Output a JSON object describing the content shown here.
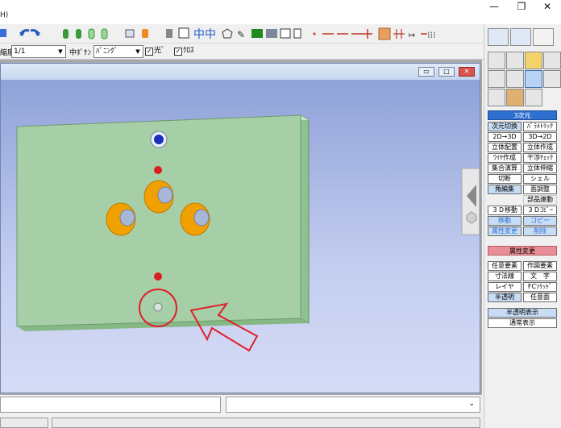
{
  "window": {
    "menu_fragment": "H)",
    "minimize": "—",
    "restore": "❐",
    "close": "✕"
  },
  "toolbar2": {
    "scale_label": "縮度",
    "scale_value": "1/1",
    "line_type_label": "中ﾎﾟｹﾝ",
    "line_type_value": "ﾊﾟﾆﾝｸﾞ",
    "check1_label": "光ﾞ",
    "check2_label": "ｸﾛｽ"
  },
  "child_window": {
    "min": "▭",
    "max": "□",
    "close": "✕"
  },
  "panel": {
    "mode_header": "3次元",
    "commands": [
      {
        "left": "次元切換",
        "right": "ﾊﾟﾗﾒﾄﾘｯｸ"
      },
      {
        "left": "2D→3D",
        "right": "3D→2D"
      },
      {
        "left": "立体配置",
        "right": "立体作成"
      },
      {
        "left": "ﾜｲﾔ作成",
        "right": "干渉ﾁｪｯｸ"
      },
      {
        "left": "集合演算",
        "right": "立体伸縮"
      },
      {
        "left": "切断",
        "right": "シェル"
      },
      {
        "left": "角編集",
        "right": "面調整"
      },
      {
        "left": "",
        "right": "部品連動"
      },
      {
        "left": "３Ｄ移動",
        "right": "３Ｄｺﾋﾟｰ"
      },
      {
        "left": "移動",
        "right": "コピー"
      },
      {
        "left": "属性変更",
        "right": "削除"
      }
    ],
    "attr_header": "属性変更",
    "attr_commands": [
      {
        "left": "任意要素",
        "right": "作図要素"
      },
      {
        "left": "寸法線",
        "right": "文　字"
      },
      {
        "left": "レイヤ",
        "right": "FCｿﾘｯﾄﾞ"
      },
      {
        "left": "半透明",
        "right": "任意面"
      }
    ],
    "display_commands": [
      "半透明表示",
      "通常表示"
    ]
  },
  "colors": {
    "plate_face": "#a7cfa7",
    "plate_edge": "#7fb07f",
    "annotation_red": "#e0202a",
    "boss_orange": "#f0a000",
    "accent_blue": "#2f6fd0"
  }
}
